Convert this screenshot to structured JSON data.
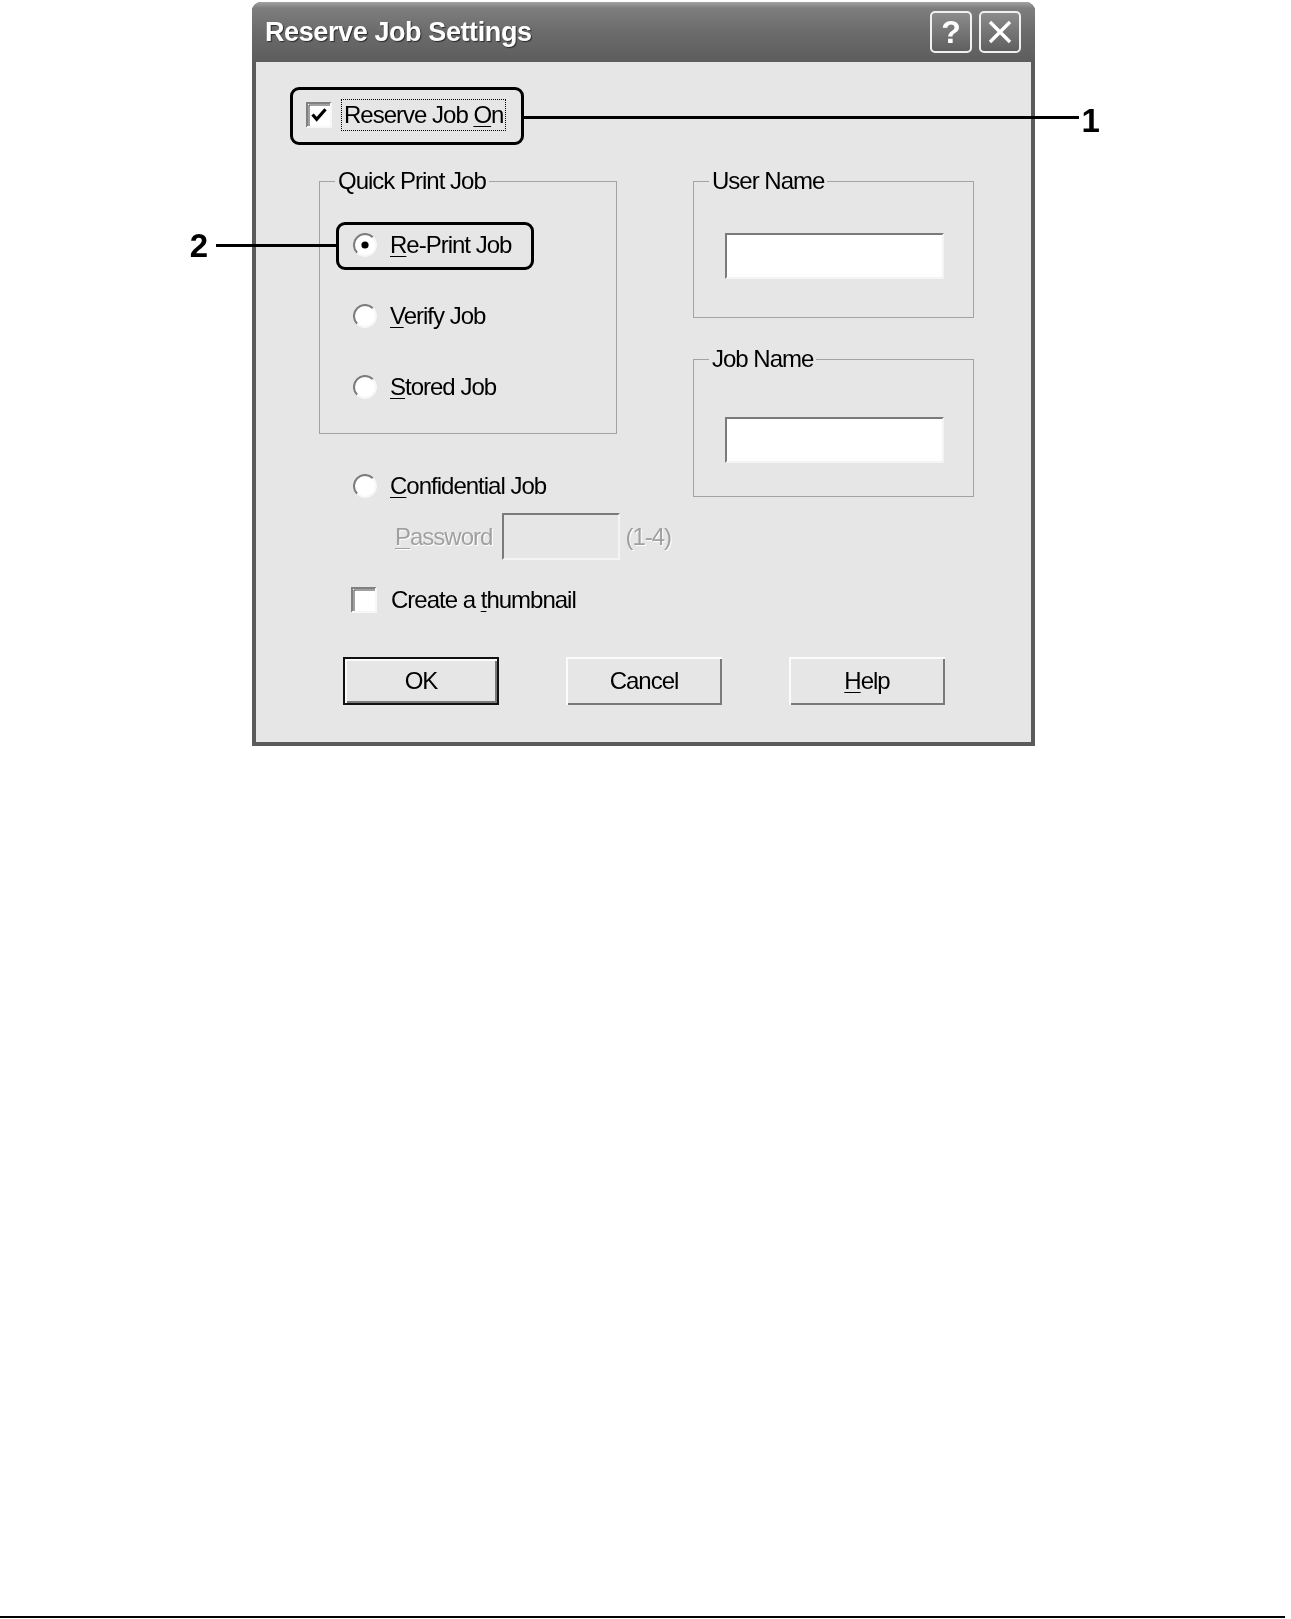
{
  "window": {
    "title": "Reserve Job Settings",
    "help_button": "?"
  },
  "reserve_job": {
    "label": "Reserve Job On",
    "underline_last_word": true,
    "checked": true,
    "focused": true,
    "callout": {
      "number": "1",
      "number_on_left": false
    }
  },
  "quick_print_job": {
    "title": "Quick Print Job",
    "options": [
      {
        "label": "Re-Print Job",
        "underline_initial": true,
        "selected": true,
        "callout": {
          "number": "2",
          "number_on_left": true
        }
      },
      {
        "label": "Verify Job",
        "underline_initial": true,
        "selected": false
      },
      {
        "label": "Stored Job",
        "underline_initial": true,
        "selected": false
      }
    ]
  },
  "user_name": {
    "title": "User Name"
  },
  "job_name": {
    "title": "Job Name"
  },
  "confidential_job": {
    "label": "Confidential Job",
    "underline_initial": true,
    "selected": false
  },
  "password": {
    "label": "Password",
    "underline_initial": true,
    "disabled": true,
    "hint": "(1-4)"
  },
  "create_thumbnail": {
    "label": "Create a thumbnail",
    "underline_last_word": true,
    "checked": false
  },
  "buttons": [
    {
      "label": "OK",
      "underline_initial": false,
      "default": true
    },
    {
      "label": "Cancel",
      "underline_initial": false,
      "default": false
    },
    {
      "label": "Help",
      "underline_initial": true,
      "default": false
    }
  ]
}
